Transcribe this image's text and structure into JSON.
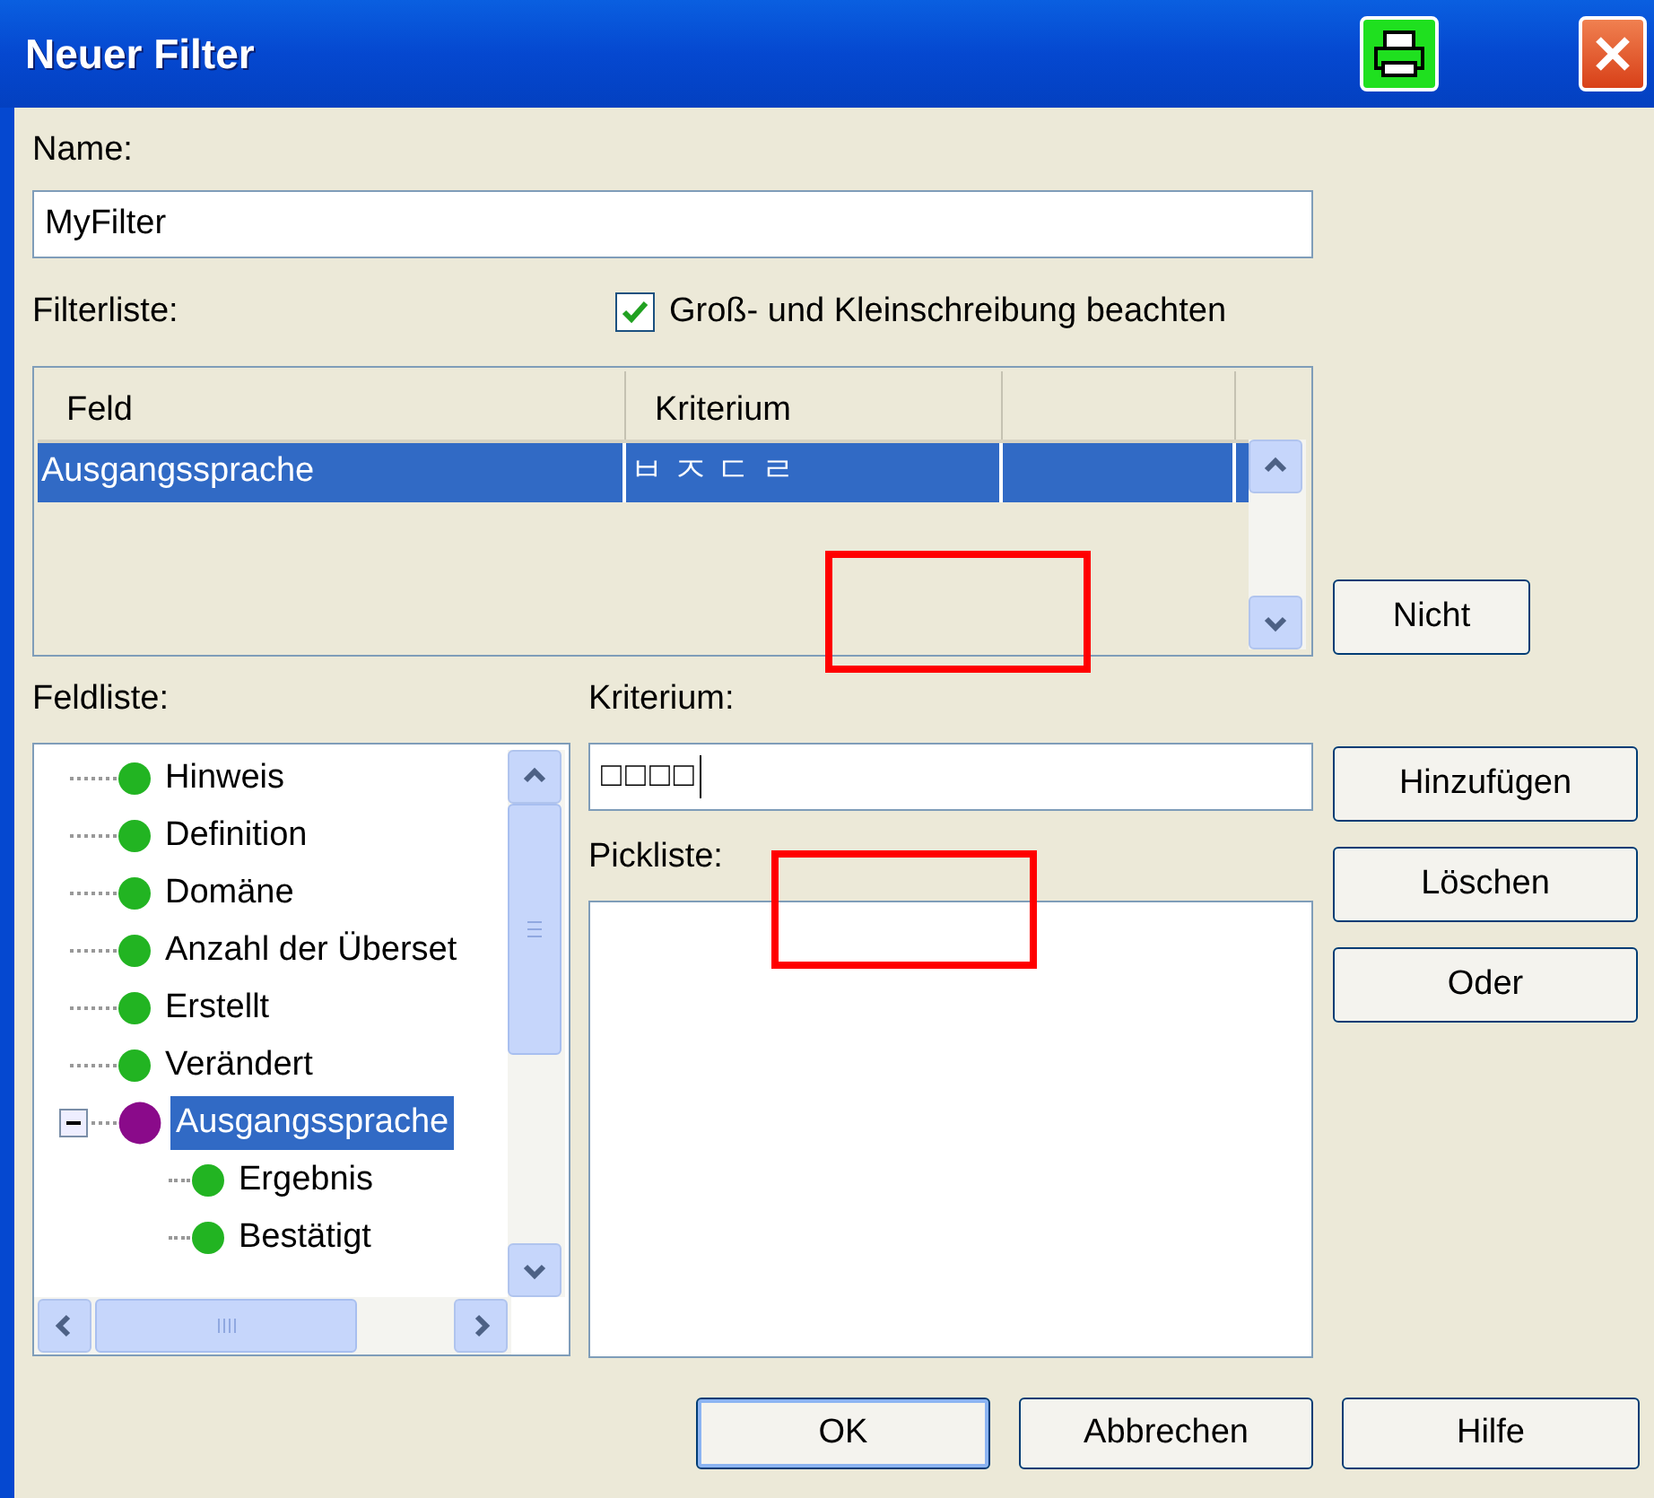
{
  "window": {
    "title": "Neuer Filter"
  },
  "name_label": "Name:",
  "name_value": "MyFilter",
  "filter_list_label": "Filterliste:",
  "case_sensitive": {
    "label": "Groß- und Kleinschreibung beachten",
    "checked": true
  },
  "filter_table": {
    "columns": [
      "Feld",
      "Kriterium",
      ""
    ],
    "rows": [
      {
        "cells": [
          "Ausgangssprache",
          "ㅂ ㅈ ㄷ ㄹ",
          ""
        ],
        "selected": true
      }
    ]
  },
  "not_button": "Nicht",
  "field_list_label": "Feldliste:",
  "field_tree": [
    {
      "label": "Hinweis",
      "color": "#22b422",
      "selected": false
    },
    {
      "label": "Definition",
      "color": "#22b422",
      "selected": false
    },
    {
      "label": "Domäne",
      "color": "#22b422",
      "selected": false
    },
    {
      "label": "Anzahl der Überset",
      "color": "#22b422",
      "selected": false
    },
    {
      "label": "Erstellt",
      "color": "#22b422",
      "selected": false
    },
    {
      "label": "Verändert",
      "color": "#22b422",
      "selected": false
    },
    {
      "label": "Ausgangssprache",
      "color": "#8a0a8a",
      "selected": true,
      "expanded": true,
      "children": [
        {
          "label": "Ergebnis",
          "color": "#22b422",
          "selected": false
        },
        {
          "label": "Bestätigt",
          "color": "#22b422",
          "selected": false
        }
      ]
    }
  ],
  "criterion_label": "Kriterium:",
  "criterion_value": "□□□□",
  "picklist_label": "Pickliste:",
  "side_buttons": [
    "Hinzufügen",
    "Löschen",
    "Oder"
  ],
  "dialog_buttons": [
    {
      "label": "OK",
      "default": true
    },
    {
      "label": "Abbrechen",
      "default": false
    },
    {
      "label": "Hilfe",
      "default": false
    }
  ],
  "annotations": [
    {
      "color": "#ff0000"
    },
    {
      "color": "#ff0000"
    }
  ]
}
